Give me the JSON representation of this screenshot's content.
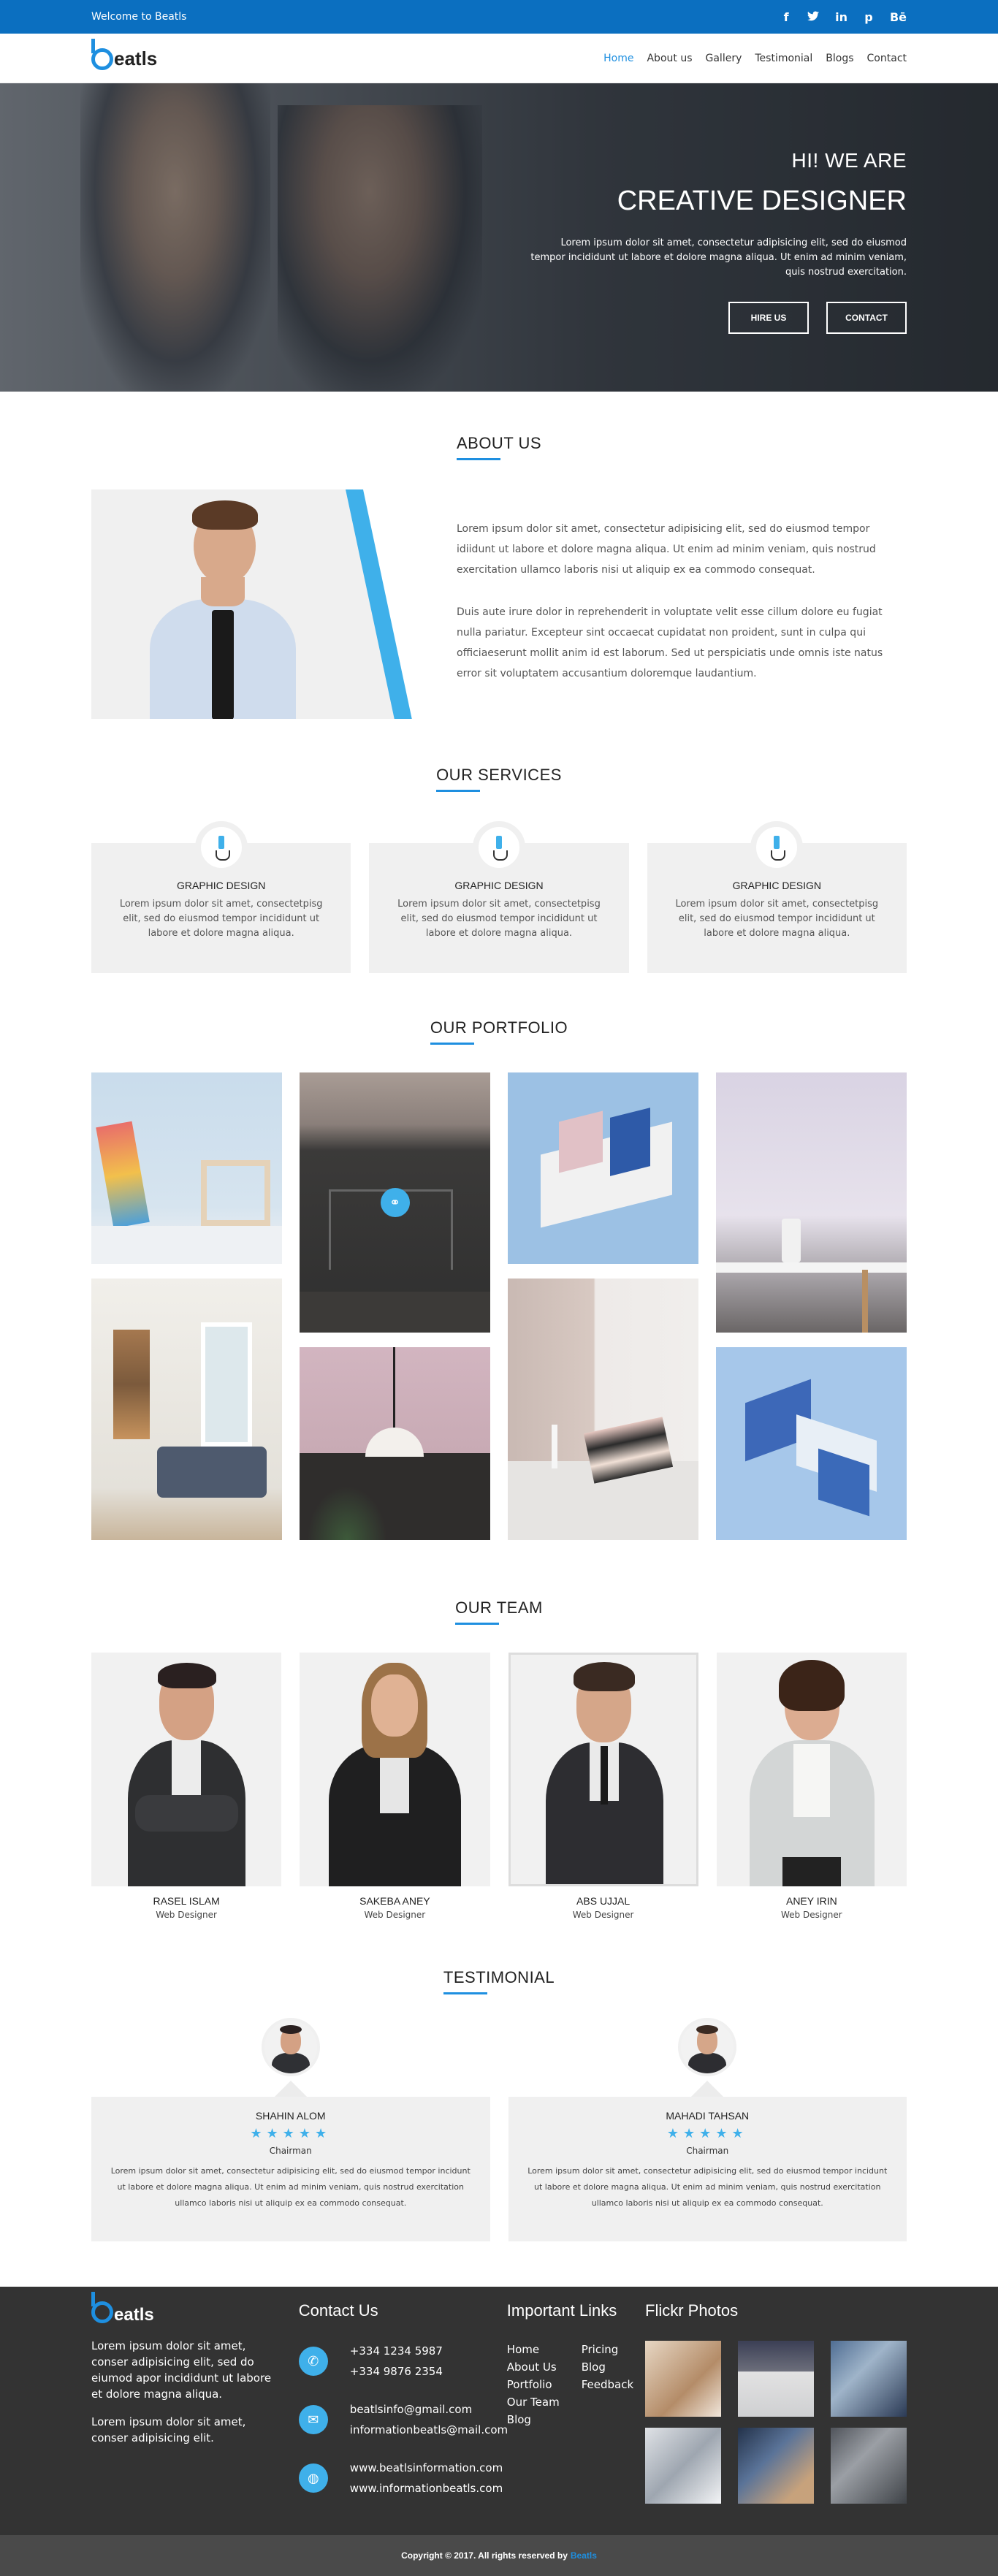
{
  "topbar": {
    "welcome": "Welcome to Beatls",
    "social": [
      "f",
      "t",
      "in",
      "p",
      "Bē"
    ],
    "color": "#0b6fc0"
  },
  "brand": {
    "logo_text": "eatls",
    "accent": "#1e8fe0"
  },
  "nav": {
    "items": [
      "Home",
      "About us",
      "Gallery",
      "Testimonial",
      "Blogs",
      "Contact"
    ],
    "active": "Home"
  },
  "hero": {
    "kicker": "HI! WE ARE",
    "title": "CREATIVE DESIGNER",
    "description": "Lorem ipsum dolor sit amet, consectetur adipisicing elit, sed do eiusmod tempor incididunt ut labore et dolore magna aliqua. Ut enim ad minim veniam, quis nostrud exercitation.",
    "btn_hire": "HIRE US",
    "btn_contact": "CONTACT"
  },
  "about": {
    "title": "ABOUT US",
    "p1": "Lorem ipsum dolor sit amet, consectetur adipisicing elit, sed do eiusmod tempor idiidunt ut labore et dolore magna aliqua. Ut enim ad minim veniam, quis nostrud exercitation ullamco laboris nisi ut aliquip ex ea commodo consequat.",
    "p2": "Duis aute irure dolor in reprehenderit in voluptate velit esse cillum dolore eu fugiat nulla pariatur. Excepteur sint occaecat cupidatat non proident, sunt in culpa qui officiaeserunt mollit anim id est laborum. Sed ut perspiciatis unde omnis iste natus error sit voluptatem accusantium doloremque laudantium."
  },
  "services": {
    "title": "OUR SERVICES",
    "items": [
      {
        "title": "GRAPHIC DESIGN",
        "text": "Lorem ipsum dolor sit amet, consectetpisg elit, sed do eiusmod tempor incididunt ut labore et dolore magna aliqua."
      },
      {
        "title": "GRAPHIC DESIGN",
        "text": "Lorem ipsum dolor sit amet, consectetpisg elit, sed do eiusmod tempor incididunt ut labore et dolore magna aliqua."
      },
      {
        "title": "GRAPHIC DESIGN",
        "text": "Lorem ipsum dolor sit amet, consectetpisg elit, sed do eiusmod tempor incididunt ut labore et dolore magna aliqua."
      }
    ]
  },
  "portfolio": {
    "title": "OUR PORTFOLIO",
    "link_icon": "link-icon"
  },
  "team": {
    "title": "OUR TEAM",
    "members": [
      {
        "name": "RASEL ISLAM",
        "role": "Web Designer"
      },
      {
        "name": "SAKEBA ANEY",
        "role": "Web Designer"
      },
      {
        "name": "ABS UJJAL",
        "role": "Web Designer"
      },
      {
        "name": "ANEY IRIN",
        "role": "Web Designer"
      }
    ]
  },
  "testimonial": {
    "title": "TESTIMONIAL",
    "items": [
      {
        "name": "SHAHIN ALOM",
        "stars": "★★★★★",
        "rating": 4.5,
        "role": "Chairman",
        "text": "Lorem ipsum dolor sit amet, consectetur adipisicing elit, sed do eiusmod tempor incidunt ut labore et dolore magna aliqua. Ut enim ad minim veniam, quis nostrud exercitation ullamco laboris nisi ut aliquip ex ea commodo consequat."
      },
      {
        "name": "MAHADI TAHSAN",
        "stars": "★★★★★",
        "rating": 4.5,
        "role": "Chairman",
        "text": "Lorem ipsum dolor sit amet, consectetur adipisicing elit, sed do eiusmod tempor incidunt ut labore et dolore magna aliqua. Ut enim ad minim veniam, quis nostrud exercitation ullamco laboris nisi ut aliquip ex ea commodo consequat."
      }
    ]
  },
  "footer": {
    "about1": "Lorem ipsum dolor sit amet, conser adipisicing elit, sed do eiumod apor incididunt ut labore et dolore magna aliqua.",
    "about2": "Lorem ipsum dolor sit amet, conser adipisicing elit.",
    "contact_title": "Contact Us",
    "phone1": "+334 1234 5987",
    "phone2": "+334 9876 2354",
    "email1": "beatlsinfo@gmail.com",
    "email2": "informationbeatls@mail.com",
    "web1": "www.beatlsinformation.com",
    "web2": "www.informationbeatls.com",
    "links_title": "Important Links",
    "links_col1": [
      "Home",
      "About Us",
      "Portfolio",
      "Our Team",
      "Blog"
    ],
    "links_col2": [
      "Pricing",
      "Blog",
      "Feedback"
    ],
    "flickr_title": "Flickr Photos",
    "copyright": "Copyright © 2017. All rights reserved by",
    "copyright_brand": "Beatls"
  }
}
